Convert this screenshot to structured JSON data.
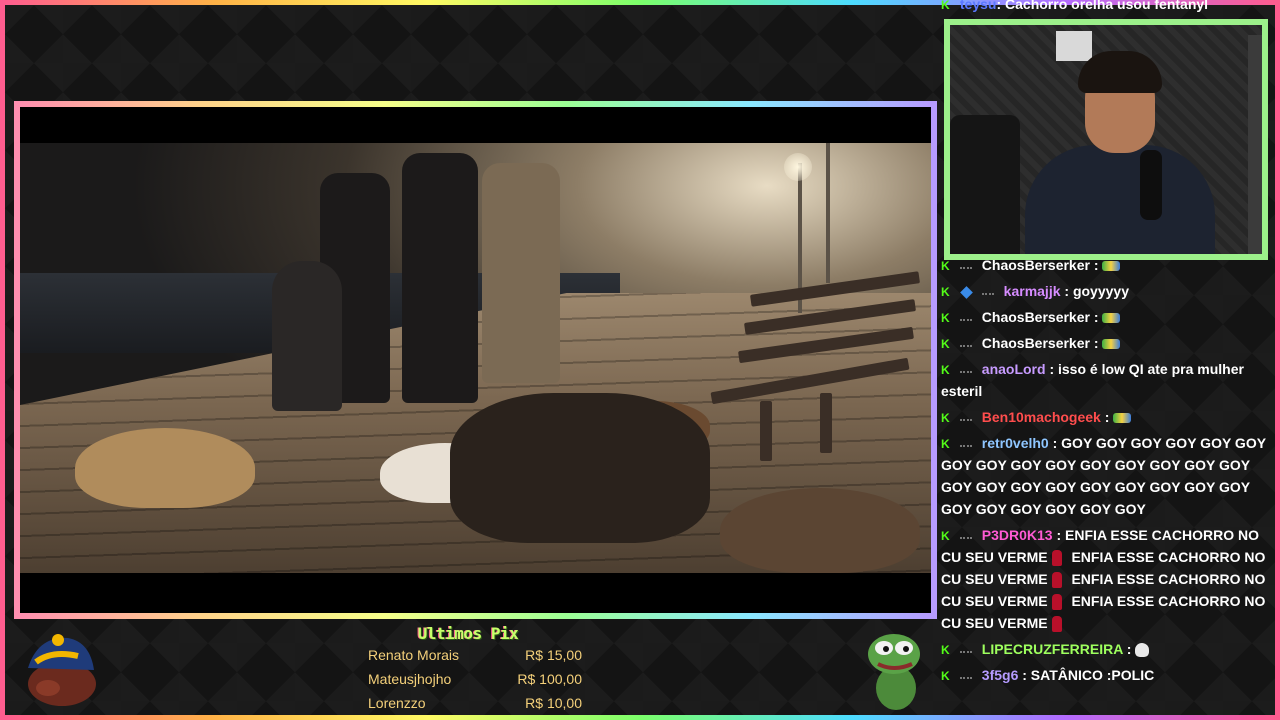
{
  "chat": {
    "top_message": {
      "user": "teysu",
      "text": ": Cachorro orelha usou fentanyl",
      "user_color": "#5a78ff"
    },
    "messages": [
      {
        "user": "ChaosBerserker",
        "user_color": "#ffffff",
        "text": " : ",
        "emote": "rainbow-bar-emote"
      },
      {
        "user": "karmajjk",
        "user_color": "#d68cff",
        "text": " : goyyyyy",
        "badge": "cube-badge"
      },
      {
        "user": "ChaosBerserker",
        "user_color": "#ffffff",
        "text": " : ",
        "emote": "rainbow-bar-emote"
      },
      {
        "user": "ChaosBerserker",
        "user_color": "#ffffff",
        "text": " : ",
        "emote": "rainbow-bar-emote"
      },
      {
        "user": "anaoLord",
        "user_color": "#c79bff",
        "text": " : isso é low QI ate pra mulher esteril"
      },
      {
        "user": "Ben10machogeek",
        "user_color": "#ff4d4d",
        "text": " : ",
        "emote": "rainbow-bar-emote"
      },
      {
        "user": "retr0velh0",
        "user_color": "#8fc6ff",
        "text": " : GOY GOY GOY GOY GOY GOY GOY GOY GOY GOY GOY GOY GOY GOY GOY GOY GOY GOY GOY GOY GOY GOY GOY GOY GOY GOY GOY GOY GOY GOY"
      },
      {
        "user": "P3DR0K13",
        "user_color": "#ff5bd4",
        "text": " : ENFIA ESSE CACHORRO NO CU SEU VERME",
        "repeat": " ENFIA ESSE CACHORRO NO CU SEU VERME",
        "repeat_count": 3
      },
      {
        "user": "LIPECRUZFERREIRA",
        "user_color": "#9eff5e",
        "text": " : ",
        "emote": "skull-emote"
      },
      {
        "user": "3f5g6",
        "user_color": "#b59bff",
        "text": " : SATÂNICO :POLIC"
      }
    ]
  },
  "donations": {
    "title": "Ultimos Pix",
    "rows": [
      {
        "name": "Renato Morais",
        "amount": "R$ 15,00"
      },
      {
        "name": "Mateusjhojho",
        "amount": "R$ 100,00"
      },
      {
        "name": "Lorenzzo",
        "amount": "R$ 10,00"
      }
    ]
  },
  "colors": {
    "chat_badge": "#53fc18",
    "webcam_border": "#9cf08a",
    "donor_text": "#f4d07a"
  }
}
